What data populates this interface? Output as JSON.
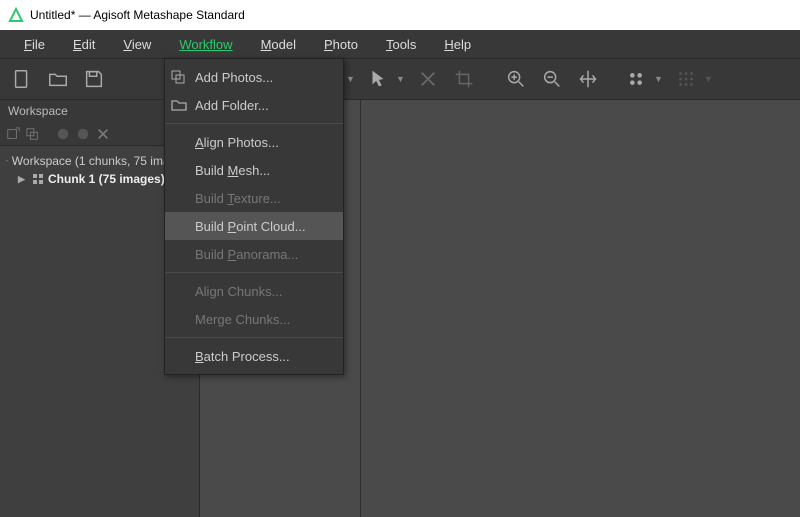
{
  "window": {
    "title": "Untitled* — Agisoft Metashape Standard"
  },
  "menubar": {
    "file": "File",
    "edit": "Edit",
    "view": "View",
    "workflow": "Workflow",
    "model": "Model",
    "photo": "Photo",
    "tools": "Tools",
    "help": "Help"
  },
  "workspace": {
    "panel_title": "Workspace",
    "root": "Workspace (1 chunks, 75 images)",
    "chunk": "Chunk 1 (75 images)"
  },
  "workflow_menu": {
    "add_photos": "Add Photos...",
    "add_folder": "Add Folder...",
    "align_photos": "Align Photos...",
    "build_mesh": "Build Mesh...",
    "build_texture": "Build Texture...",
    "build_point_cloud": "Build Point Cloud...",
    "build_panorama": "Build Panorama...",
    "align_chunks": "Align Chunks...",
    "merge_chunks": "Merge Chunks...",
    "batch_process": "Batch Process..."
  }
}
